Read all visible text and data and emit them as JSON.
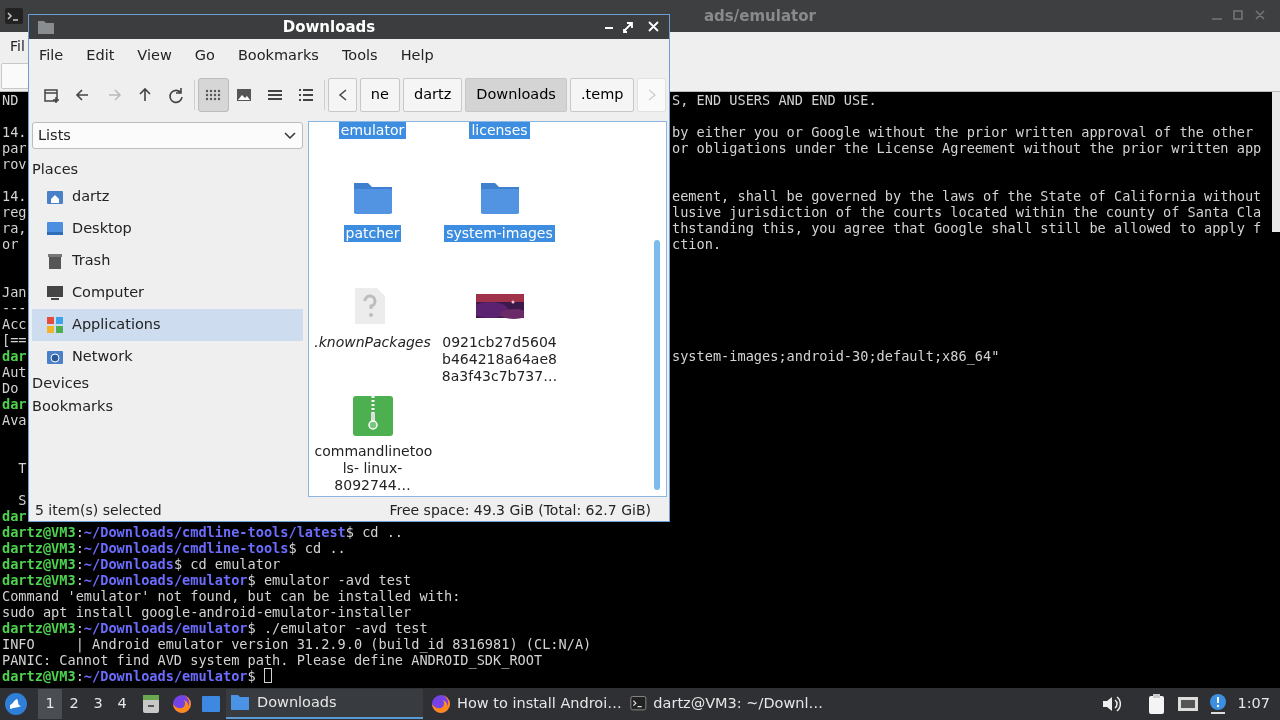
{
  "terminal_window": {
    "title": "ads/emulator",
    "menu": [
      "Fil"
    ],
    "lines": [
      {
        "left": [
          {
            "text": "ND"
          }
        ],
        "right": [
          {
            "text": "S, END USERS AND END USE."
          }
        ]
      },
      {
        "kind": "blank"
      },
      {
        "left": [
          {
            "text": "14."
          }
        ],
        "right": [
          {
            "text": "by either you or Google without the prior written approval of the other"
          }
        ]
      },
      {
        "left": [
          {
            "text": "par"
          }
        ],
        "right": [
          {
            "text": "or obligations under the License Agreement without the prior written app"
          }
        ]
      },
      {
        "left": [
          {
            "text": "rov"
          }
        ]
      },
      {
        "kind": "blank"
      },
      {
        "left": [
          {
            "text": "14."
          }
        ],
        "right": [
          {
            "text": "eement, shall be governed by the laws of the State of California without"
          }
        ]
      },
      {
        "left": [
          {
            "text": "reg"
          }
        ],
        "right": [
          {
            "text": "lusive jurisdiction of the courts located within the county of Santa Cla"
          }
        ]
      },
      {
        "left": [
          {
            "text": "ra,"
          }
        ],
        "right": [
          {
            "text": "thstanding this, you agree that Google shall still be allowed to apply f"
          }
        ]
      },
      {
        "left": [
          {
            "text": "or"
          }
        ],
        "right": [
          {
            "text": "ction."
          }
        ]
      },
      {
        "kind": "blank"
      },
      {
        "kind": "blank"
      },
      {
        "left": [
          {
            "text": "Jan"
          }
        ]
      },
      {
        "left": [
          {
            "text": "---"
          }
        ]
      },
      {
        "left": [
          {
            "text": "Acc"
          }
        ]
      },
      {
        "left": [
          {
            "text": "[=="
          }
        ]
      },
      {
        "left": [
          {
            "text": "dar",
            "kind": "user"
          }
        ],
        "right": [
          {
            "text": "system-images;android-30;default;x86_64\""
          }
        ]
      },
      {
        "left": [
          {
            "text": "Aut"
          }
        ]
      },
      {
        "left": [
          {
            "text": "Do"
          }
        ]
      },
      {
        "left": [
          {
            "text": "dar",
            "kind": "user"
          }
        ]
      },
      {
        "left": [
          {
            "text": "Ava"
          }
        ]
      },
      {
        "kind": "blank"
      },
      {
        "kind": "blank"
      },
      {
        "left": [
          {
            "text": "  T"
          }
        ]
      },
      {
        "kind": "blank"
      },
      {
        "left": [
          {
            "text": "  S"
          }
        ]
      },
      {
        "left": [
          {
            "text": "dar",
            "kind": "user"
          }
        ]
      },
      {
        "left": [
          {
            "text": "dartz@VM3",
            "kind": "user"
          },
          {
            "text": ":"
          },
          {
            "text": "~/Downloads/cmdline-tools/latest",
            "kind": "path"
          },
          {
            "text": "$ cd .."
          }
        ]
      },
      {
        "left": [
          {
            "text": "dartz@VM3",
            "kind": "user"
          },
          {
            "text": ":"
          },
          {
            "text": "~/Downloads/cmdline-tools",
            "kind": "path"
          },
          {
            "text": "$ cd .."
          }
        ]
      },
      {
        "left": [
          {
            "text": "dartz@VM3",
            "kind": "user"
          },
          {
            "text": ":"
          },
          {
            "text": "~/Downloads",
            "kind": "path"
          },
          {
            "text": "$ cd emulator"
          }
        ]
      },
      {
        "left": [
          {
            "text": "dartz@VM3",
            "kind": "user"
          },
          {
            "text": ":"
          },
          {
            "text": "~/Downloads/emulator",
            "kind": "path"
          },
          {
            "text": "$ emulator -avd test"
          }
        ]
      },
      {
        "left": [
          {
            "text": "Command 'emulator' not found, but can be installed with:"
          }
        ]
      },
      {
        "left": [
          {
            "text": "sudo apt install google-android-emulator-installer"
          }
        ]
      },
      {
        "left": [
          {
            "text": "dartz@VM3",
            "kind": "user"
          },
          {
            "text": ":"
          },
          {
            "text": "~/Downloads/emulator",
            "kind": "path"
          },
          {
            "text": "$ ./emulator -avd test"
          }
        ]
      },
      {
        "left": [
          {
            "text": "INFO     | Android emulator version 31.2.9.0 (build_id 8316981) (CL:N/A)"
          }
        ]
      },
      {
        "left": [
          {
            "text": "PANIC: Cannot find AVD system path. Please define ANDROID_SDK_ROOT"
          }
        ]
      },
      {
        "left": [
          {
            "text": "dartz@VM3",
            "kind": "user"
          },
          {
            "text": ":"
          },
          {
            "text": "~/Downloads/emulator",
            "kind": "path"
          },
          {
            "text": "$ "
          }
        ],
        "cursor": true
      }
    ]
  },
  "file_manager": {
    "title": "Downloads",
    "menu": [
      "File",
      "Edit",
      "View",
      "Go",
      "Bookmarks",
      "Tools",
      "Help"
    ],
    "nav_buttons": [
      {
        "kind": "new-tab",
        "disabled": false
      },
      {
        "kind": "back",
        "disabled": false
      },
      {
        "kind": "forward",
        "disabled": true
      },
      {
        "kind": "up",
        "disabled": false
      },
      {
        "kind": "reload",
        "disabled": false
      }
    ],
    "view_buttons": [
      {
        "kind": "icons",
        "selected": true
      },
      {
        "kind": "thumbnails",
        "selected": false
      },
      {
        "kind": "compact",
        "selected": false
      },
      {
        "kind": "details",
        "selected": false
      }
    ],
    "path_scroll": [
      {
        "kind": "left",
        "disabled": false
      },
      {
        "kind": "right",
        "disabled": true
      }
    ],
    "breadcrumbs": [
      {
        "label": "ne",
        "selected": false
      },
      {
        "label": "dartz",
        "selected": false
      },
      {
        "label": "Downloads",
        "selected": true
      },
      {
        "label": ".temp",
        "selected": false
      }
    ],
    "side_view": "Lists",
    "places_heading": "Places",
    "places": [
      {
        "label": "dartz",
        "kind": "home",
        "selected": false
      },
      {
        "label": "Desktop",
        "kind": "desktop",
        "selected": false
      },
      {
        "label": "Trash",
        "kind": "trash",
        "selected": false
      },
      {
        "label": "Computer",
        "kind": "computer",
        "selected": false
      },
      {
        "label": "Applications",
        "kind": "apps",
        "selected": true
      },
      {
        "label": "Network",
        "kind": "network",
        "selected": false
      }
    ],
    "sections": [
      "Devices",
      "Bookmarks"
    ],
    "files": [
      {
        "name": "emulator",
        "kind": "label-only",
        "selected": true,
        "hidden": false
      },
      {
        "name": "licenses",
        "kind": "label-only",
        "selected": true,
        "hidden": false
      },
      {
        "name": "patcher",
        "kind": "folder",
        "selected": true,
        "hidden": false
      },
      {
        "name": "system-images",
        "kind": "folder",
        "selected": true,
        "hidden": false
      },
      {
        "name": ".knownPackages",
        "kind": "unknown",
        "selected": false,
        "hidden": true
      },
      {
        "name": "0921cb27d5604 b464218a64ae8 8a3f43c7b737…",
        "selected": false,
        "hidden": false
      },
      {
        "name": "commandlinetoo ls- linux-8092744…",
        "kind": "archive",
        "selected": false,
        "hidden": false
      }
    ],
    "status_bar": {
      "selection": "5 item(s) selected",
      "free_space": "Free space: 49.3 GiB (Total: 62.7 GiB)"
    }
  },
  "taskbar": {
    "workspaces": [
      {
        "label": "1",
        "selected": true
      },
      {
        "label": "2",
        "selected": false
      },
      {
        "label": "3",
        "selected": false
      },
      {
        "label": "4",
        "selected": false
      }
    ],
    "tasks": [
      {
        "label": "Downloads",
        "kind": "files",
        "active": true
      },
      {
        "label": "How to install Androi…",
        "kind": "browser",
        "active": false
      },
      {
        "label": "dartz@VM3: ~/Downl…",
        "kind": "terminal",
        "active": false
      }
    ],
    "clock": "1:07"
  }
}
